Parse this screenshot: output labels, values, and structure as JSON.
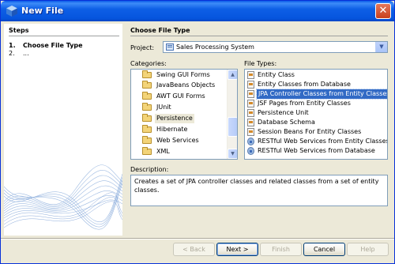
{
  "window": {
    "title": "New File",
    "close_glyph": "✕"
  },
  "steps": {
    "title": "Steps",
    "items": [
      {
        "num": "1.",
        "label": "Choose File Type"
      },
      {
        "num": "2.",
        "label": "..."
      }
    ]
  },
  "main": {
    "title": "Choose File Type",
    "project": {
      "label": "Project:",
      "value": "Sales Processing System"
    },
    "categories": {
      "label": "Categories:",
      "items": [
        "Swing GUI Forms",
        "JavaBeans Objects",
        "AWT GUI Forms",
        "JUnit",
        "Persistence",
        "Hibernate",
        "Web Services",
        "XML"
      ],
      "selected": "Persistence"
    },
    "file_types": {
      "label": "File Types:",
      "items": [
        "Entity Class",
        "Entity Classes from Database",
        "JPA Controller Classes from Entity Classes",
        "JSF Pages from Entity Classes",
        "Persistence Unit",
        "Database Schema",
        "Session Beans For Entity Classes",
        "RESTful Web Services from Entity Classes",
        "RESTful Web Services from Database"
      ],
      "selected": "JPA Controller Classes from Entity Classes"
    },
    "description": {
      "label": "Description:",
      "text": "Creates a set of JPA controller classes and related classes from a set of entity classes."
    }
  },
  "buttons": {
    "back": "< Back",
    "next": "Next >",
    "finish": "Finish",
    "cancel": "Cancel",
    "help": "Help"
  },
  "colors": {
    "titlebar": "#0a5ae8",
    "selection": "#316ac5",
    "dialog_bg": "#ece9d8"
  }
}
